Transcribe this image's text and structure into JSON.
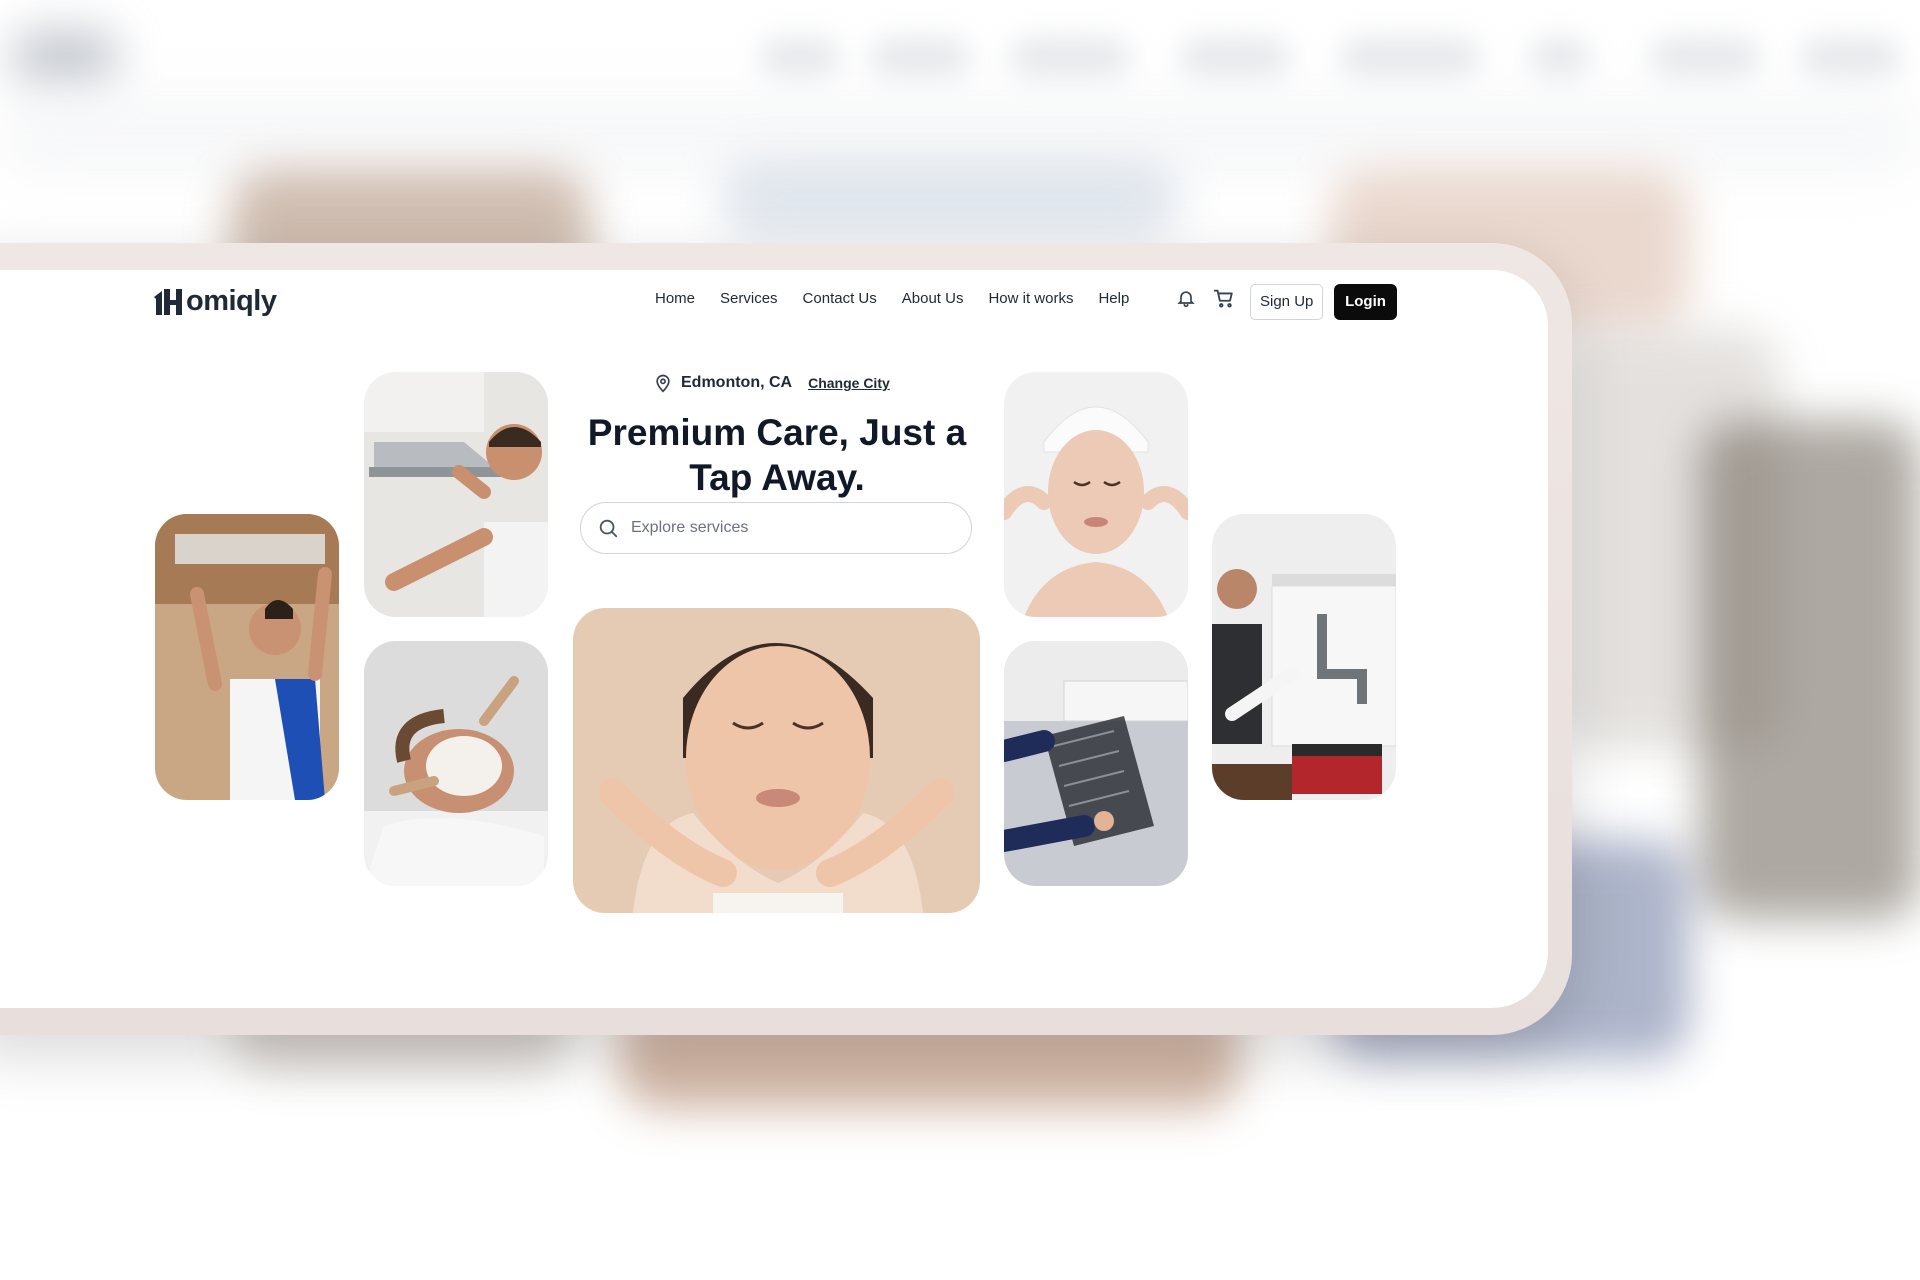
{
  "brand": {
    "name": "omiqly",
    "logo_letter": "H"
  },
  "nav": {
    "links": [
      "Home",
      "Services",
      "Contact Us",
      "About Us",
      "How it works",
      "Help"
    ],
    "icons": [
      "bell-icon",
      "cart-icon"
    ],
    "signup_label": "Sign Up",
    "login_label": "Login"
  },
  "hero": {
    "location": "Edmonton, CA",
    "change_city_label": "Change City",
    "headline": "Premium Care, Just a Tap Away.",
    "search_placeholder": "Explore services"
  },
  "tiles": [
    {
      "name": "tile-electrician",
      "subject": "electrician fixing light fixture"
    },
    {
      "name": "tile-hood-repair",
      "subject": "technician repairing range hood"
    },
    {
      "name": "tile-facial-mask",
      "subject": "facial mask treatment"
    },
    {
      "name": "tile-skincare-hero",
      "subject": "woman skincare"
    },
    {
      "name": "tile-towel-beauty",
      "subject": "woman with towel on head"
    },
    {
      "name": "tile-ac-cleaning",
      "subject": "air conditioner filter cleaning"
    },
    {
      "name": "tile-plumber",
      "subject": "plumber under sink"
    }
  ],
  "colors": {
    "primary": "#0b0b0b",
    "text": "#111827",
    "frame": "#efe7e3"
  }
}
